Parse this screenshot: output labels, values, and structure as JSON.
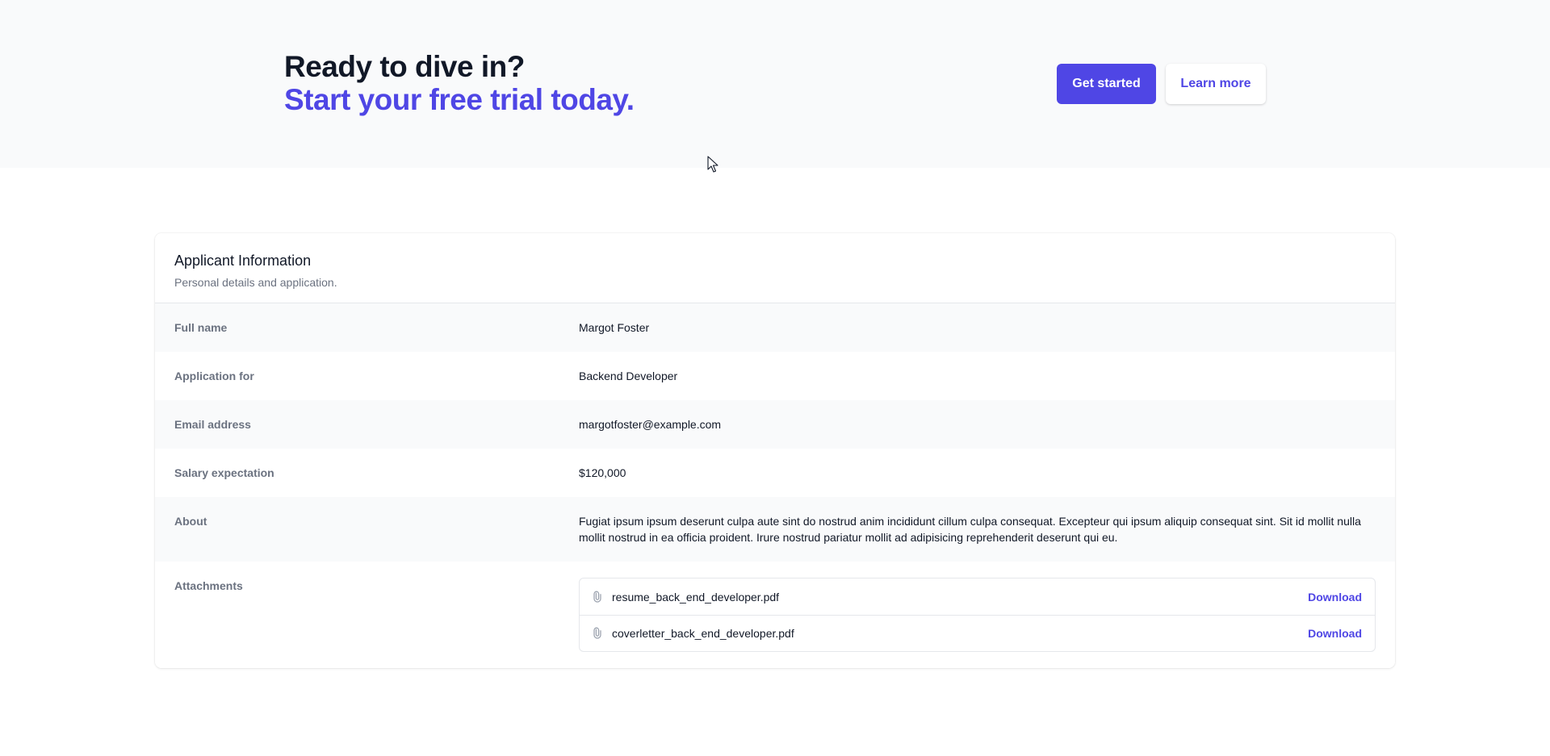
{
  "cta": {
    "heading_line1": "Ready to dive in?",
    "heading_line2": "Start your free trial today.",
    "primary_button": "Get started",
    "secondary_button": "Learn more"
  },
  "applicant": {
    "title": "Applicant Information",
    "subtitle": "Personal details and application.",
    "fields": [
      {
        "label": "Full name",
        "value": "Margot Foster"
      },
      {
        "label": "Application for",
        "value": "Backend Developer"
      },
      {
        "label": "Email address",
        "value": "margotfoster@example.com"
      },
      {
        "label": "Salary expectation",
        "value": "$120,000"
      },
      {
        "label": "About",
        "value": "Fugiat ipsum ipsum deserunt culpa aute sint do nostrud anim incididunt cillum culpa consequat. Excepteur qui ipsum aliquip consequat sint. Sit id mollit nulla mollit nostrud in ea officia proident. Irure nostrud pariatur mollit ad adipisicing reprehenderit deserunt qui eu."
      }
    ],
    "attachments_label": "Attachments",
    "attachments": [
      {
        "name": "resume_back_end_developer.pdf",
        "action": "Download",
        "icon": "paperclip-icon"
      },
      {
        "name": "coverletter_back_end_developer.pdf",
        "action": "Download",
        "icon": "paperclip-icon"
      }
    ]
  },
  "colors": {
    "accent": "#4f46e5",
    "heading": "#111827",
    "muted": "#6b7280",
    "cta_background": "#f9fafb"
  }
}
